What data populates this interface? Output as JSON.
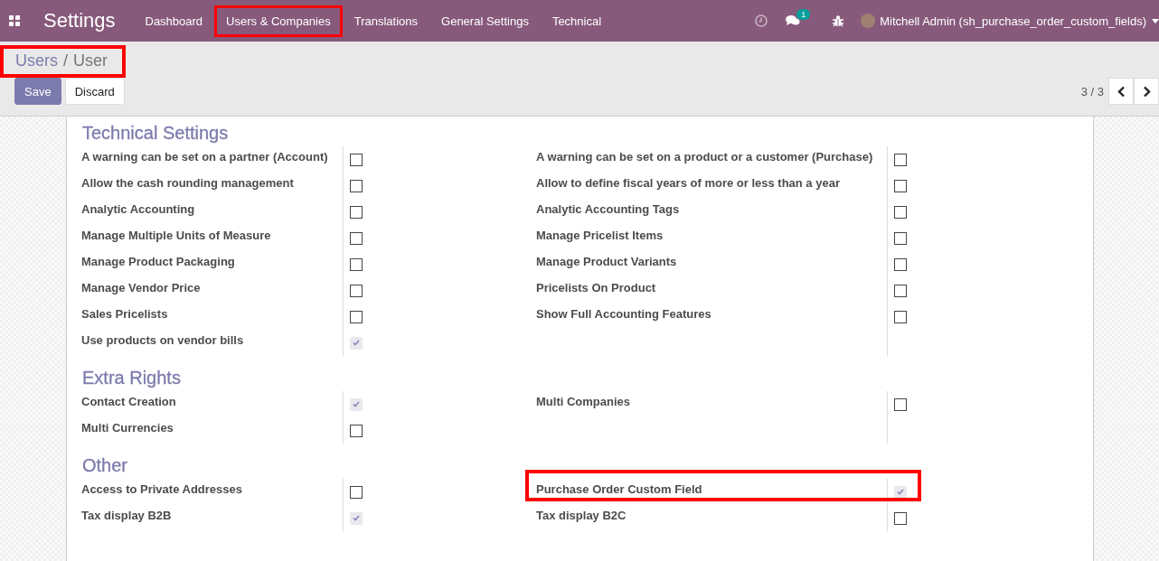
{
  "navbar": {
    "app_title": "Settings",
    "menu": [
      {
        "label": "Dashboard",
        "highlighted": false
      },
      {
        "label": "Users & Companies",
        "highlighted": true
      },
      {
        "label": "Translations",
        "highlighted": false
      },
      {
        "label": "General Settings",
        "highlighted": false
      },
      {
        "label": "Technical",
        "highlighted": false
      }
    ],
    "chat_badge": "1",
    "user": "Mitchell Admin (sh_purchase_order_custom_fields)"
  },
  "breadcrumb": {
    "items": [
      "Users",
      "User"
    ],
    "separator": "/",
    "highlighted": true
  },
  "buttons": [
    {
      "label": "Save",
      "kind": "primary"
    },
    {
      "label": "Discard",
      "kind": "secondary"
    }
  ],
  "pager": {
    "text": "3 / 3"
  },
  "sections": [
    {
      "title": "Technical Settings",
      "left": [
        {
          "label": "A warning can be set on a partner (Account)",
          "checked": false,
          "readonly": false,
          "highlighted": false
        },
        {
          "label": "Allow the cash rounding management",
          "checked": false,
          "readonly": false,
          "highlighted": false
        },
        {
          "label": "Analytic Accounting",
          "checked": false,
          "readonly": false,
          "highlighted": false
        },
        {
          "label": "Manage Multiple Units of Measure",
          "checked": false,
          "readonly": false,
          "highlighted": false
        },
        {
          "label": "Manage Product Packaging",
          "checked": false,
          "readonly": false,
          "highlighted": false
        },
        {
          "label": "Manage Vendor Price",
          "checked": false,
          "readonly": false,
          "highlighted": false
        },
        {
          "label": "Sales Pricelists",
          "checked": false,
          "readonly": false,
          "highlighted": false
        },
        {
          "label": "Use products on vendor bills",
          "checked": true,
          "readonly": true,
          "highlighted": false
        }
      ],
      "right": [
        {
          "label": "A warning can be set on a product or a customer (Purchase)",
          "checked": false,
          "readonly": false,
          "highlighted": false
        },
        {
          "label": "Allow to define fiscal years of more or less than a year",
          "checked": false,
          "readonly": false,
          "highlighted": false
        },
        {
          "label": "Analytic Accounting Tags",
          "checked": false,
          "readonly": false,
          "highlighted": false
        },
        {
          "label": "Manage Pricelist Items",
          "checked": false,
          "readonly": false,
          "highlighted": false
        },
        {
          "label": "Manage Product Variants",
          "checked": false,
          "readonly": false,
          "highlighted": false
        },
        {
          "label": "Pricelists On Product",
          "checked": false,
          "readonly": false,
          "highlighted": false
        },
        {
          "label": "Show Full Accounting Features",
          "checked": false,
          "readonly": false,
          "highlighted": false
        }
      ]
    },
    {
      "title": "Extra Rights",
      "left": [
        {
          "label": "Contact Creation",
          "checked": true,
          "readonly": true,
          "highlighted": false
        },
        {
          "label": "Multi Currencies",
          "checked": false,
          "readonly": false,
          "highlighted": false
        }
      ],
      "right": [
        {
          "label": "Multi Companies",
          "checked": false,
          "readonly": false,
          "highlighted": false
        }
      ]
    },
    {
      "title": "Other",
      "left": [
        {
          "label": "Access to Private Addresses",
          "checked": false,
          "readonly": false,
          "highlighted": false
        },
        {
          "label": "Tax display B2B",
          "checked": true,
          "readonly": true,
          "highlighted": false
        }
      ],
      "right": [
        {
          "label": "Purchase Order Custom Field",
          "checked": true,
          "readonly": true,
          "highlighted": true
        },
        {
          "label": "Tax display B2C",
          "checked": false,
          "readonly": false,
          "highlighted": false
        }
      ]
    }
  ]
}
